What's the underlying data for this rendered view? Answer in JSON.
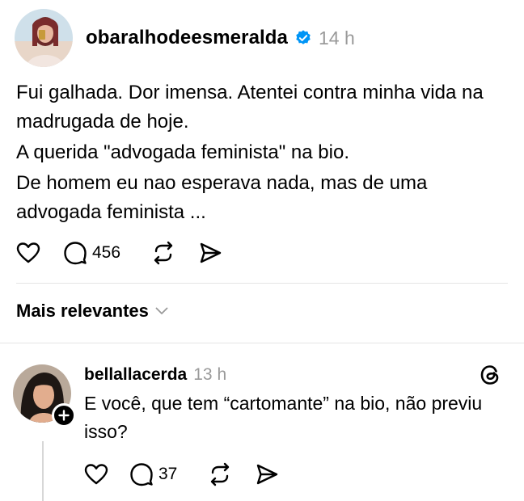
{
  "post": {
    "username": "obaralhodeesmeralda",
    "time": "14 h",
    "lines": [
      "Fui galhada. Dor imensa. Atentei contra minha vida na madrugada de hoje.",
      "A querida \"advogada feminista\" na bio.",
      "De homem eu nao esperava nada, mas de uma advogada feminista ..."
    ],
    "reply_count": "456"
  },
  "sort": {
    "label": "Mais relevantes"
  },
  "reply": {
    "username": "bellallacerda",
    "time": "13 h",
    "text": "E você, que tem “cartomante” na bio, não previu isso?",
    "reply_count": "37"
  },
  "icons": {
    "verified": "verified-badge-icon",
    "like": "heart-icon",
    "comment": "comment-bubble-icon",
    "repost": "repost-icon",
    "share": "send-icon",
    "sort": "chevron-down-icon",
    "follow": "plus-icon",
    "app": "threads-logo-icon"
  },
  "colors": {
    "verified": "#0095f6",
    "muted": "#9a9a9a",
    "divider": "#e5e5e5"
  }
}
